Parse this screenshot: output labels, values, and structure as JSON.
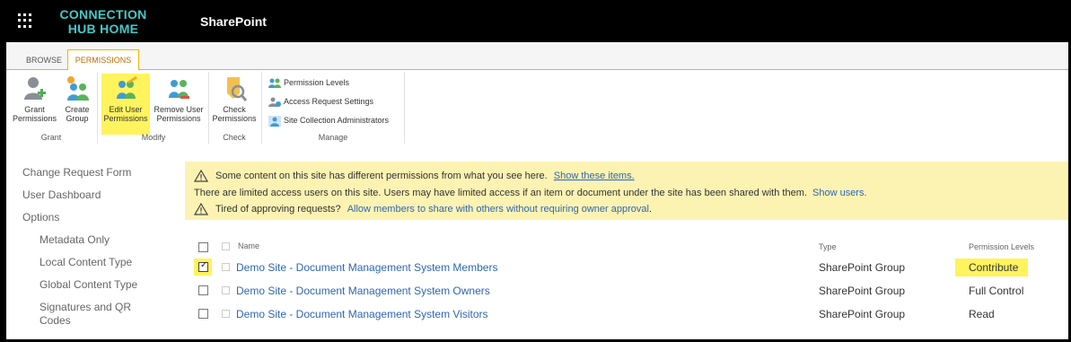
{
  "brand": {
    "line1": "CONNECTION",
    "line2": "HUB HOME"
  },
  "app_title": "SharePoint",
  "tabs": [
    {
      "label": "BROWSE"
    },
    {
      "label": "PERMISSIONS"
    }
  ],
  "ribbon": {
    "grant_permissions": [
      "Grant",
      "Permissions"
    ],
    "create_group": [
      "Create",
      "Group"
    ],
    "edit_user_permissions": [
      "Edit User",
      "Permissions"
    ],
    "remove_user_permissions": [
      "Remove User",
      "Permissions"
    ],
    "check_permissions": [
      "Check",
      "Permissions"
    ],
    "permission_levels": "Permission Levels",
    "access_request_settings": "Access Request Settings",
    "site_collection_admins": "Site Collection Administrators",
    "groups": {
      "grant": "Grant",
      "modify": "Modify",
      "check": "Check",
      "manage": "Manage"
    }
  },
  "nav": [
    "Change Request Form",
    "User Dashboard",
    "Options",
    "Metadata Only",
    "Local Content Type",
    "Global Content Type",
    "Signatures and QR Codes"
  ],
  "banner": {
    "line1": "Some content on this site has different permissions from what you see here.",
    "line1_link": "Show these items.",
    "line2": "There are limited access users on this site. Users may have limited access if an item or document under the site has been shared with them.",
    "line2_link": "Show users.",
    "line3": "Tired of approving requests?",
    "line3_link": "Allow members to share with others without requiring owner approval",
    "line3_end": "."
  },
  "table": {
    "headers": {
      "name": "Name",
      "type": "Type",
      "permission_levels": "Permission Levels"
    },
    "rows": [
      {
        "name": "Demo Site - Document Management System Members",
        "type": "SharePoint Group",
        "permission": "Contribute",
        "checked": true
      },
      {
        "name": "Demo Site - Document Management System Owners",
        "type": "SharePoint Group",
        "permission": "Full Control",
        "checked": false
      },
      {
        "name": "Demo Site - Document Management System Visitors",
        "type": "SharePoint Group",
        "permission": "Read",
        "checked": false
      }
    ]
  },
  "colors": {
    "highlight": "#fff35e",
    "link": "#2e66b3",
    "brand": "#45c8c8",
    "banner": "#fcf3b3",
    "accent_tab": "#c36b00"
  }
}
